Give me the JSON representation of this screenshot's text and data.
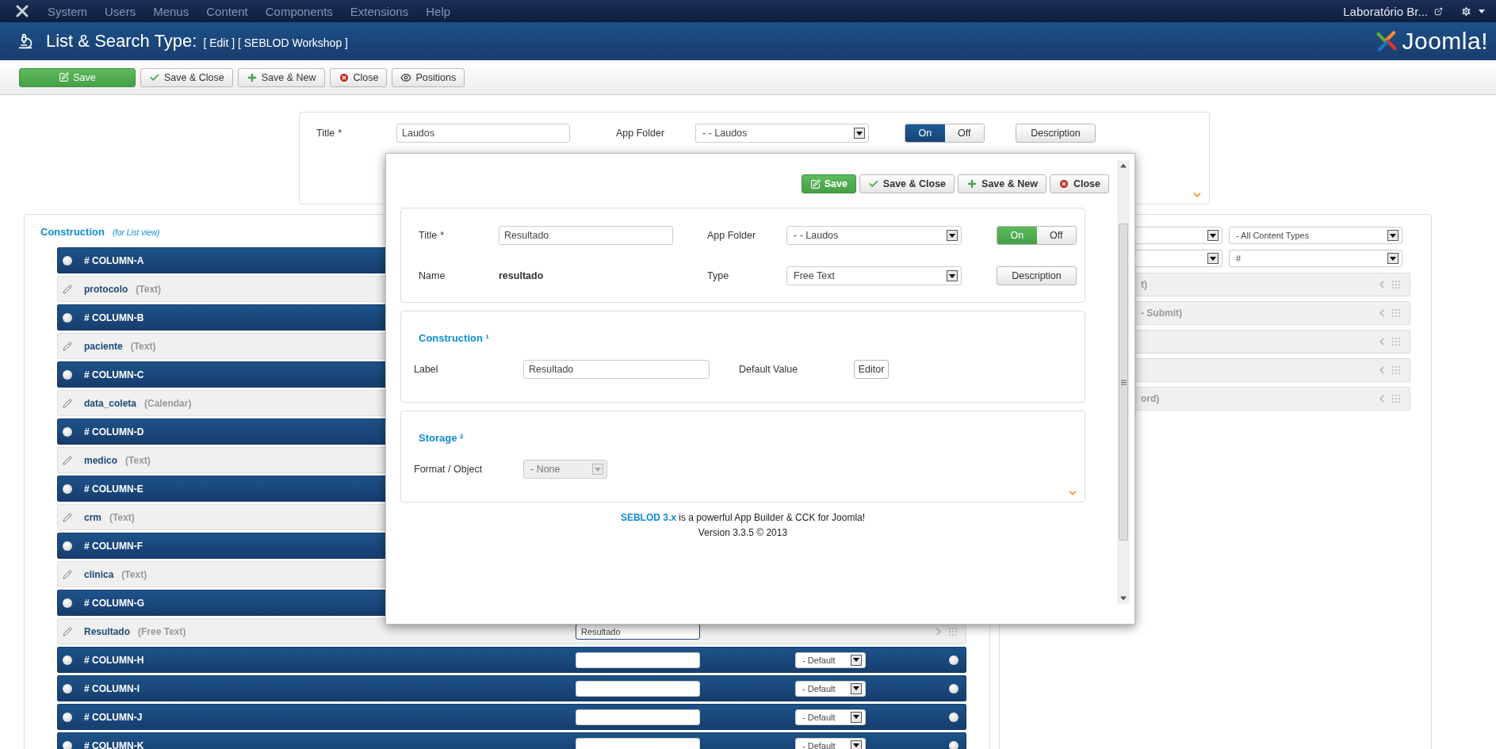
{
  "topnav": {
    "menu": [
      "System",
      "Users",
      "Menus",
      "Content",
      "Components",
      "Extensions",
      "Help"
    ],
    "site": "Laboratório Br..."
  },
  "header": {
    "title": "List & Search Type:",
    "subtitle": "[ Edit ] [ SEBLOD Workshop ]",
    "brand": "Joomla!"
  },
  "toolbar": [
    {
      "label": "Save",
      "kind": "save"
    },
    {
      "label": "Save & Close",
      "kind": "check"
    },
    {
      "label": "Save & New",
      "kind": "new"
    },
    {
      "label": "Close",
      "kind": "close"
    },
    {
      "label": "Positions",
      "kind": "view"
    }
  ],
  "main_form": {
    "title_label": "Title",
    "required": "*",
    "title_value": "Laudos",
    "folder_label": "App Folder",
    "folder_value": "- - Laudos",
    "toggle": [
      {
        "label": "On",
        "selected": true
      },
      {
        "label": "Off",
        "selected": false
      }
    ],
    "description": "Description"
  },
  "construction": {
    "title": "Construction",
    "note": "(for List view)",
    "rows": [
      {
        "kind": "column",
        "label": "# COLUMN-A"
      },
      {
        "kind": "field",
        "name": "protocolo",
        "type": "(Text)"
      },
      {
        "kind": "column",
        "label": "# COLUMN-B"
      },
      {
        "kind": "field",
        "name": "paciente",
        "type": "(Text)"
      },
      {
        "kind": "column",
        "label": "# COLUMN-C"
      },
      {
        "kind": "field",
        "name": "data_coleta",
        "type": "(Calendar)"
      },
      {
        "kind": "column",
        "label": "# COLUMN-D"
      },
      {
        "kind": "field",
        "name": "medico",
        "type": "(Text)"
      },
      {
        "kind": "column",
        "label": "# COLUMN-E"
      },
      {
        "kind": "field",
        "name": "crm",
        "type": "(Text)"
      },
      {
        "kind": "column",
        "label": "# COLUMN-F"
      },
      {
        "kind": "field",
        "name": "clinica",
        "type": "(Text)"
      },
      {
        "kind": "column",
        "label": "# COLUMN-G"
      },
      {
        "kind": "field",
        "name": "Resultado",
        "type": "(Free Text)",
        "value": "Resultado"
      },
      {
        "kind": "column",
        "label": "# COLUMN-H",
        "select": "- Default",
        "selected": false
      },
      {
        "kind": "column",
        "label": "# COLUMN-I",
        "select": "- Default",
        "selected": false
      },
      {
        "kind": "column",
        "label": "# COLUMN-J",
        "select": "- Default",
        "selected": false
      },
      {
        "kind": "column",
        "label": "# COLUMN-K",
        "select": "- Default",
        "selected": false
      }
    ]
  },
  "filters": [
    {
      "value": "- All Content Types"
    },
    {
      "value": "#"
    }
  ],
  "positions": [
    {
      "kind": "text",
      "label": "t)"
    },
    {
      "kind": "text",
      "label": "- Submit)"
    },
    {
      "kind": "blank"
    },
    {
      "kind": "blank"
    },
    {
      "kind": "text",
      "label": "ord)"
    }
  ],
  "modal": {
    "buttons": [
      {
        "label": "Save",
        "kind": "save"
      },
      {
        "label": "Save & Close",
        "kind": "check"
      },
      {
        "label": "Save & New",
        "kind": "new"
      },
      {
        "label": "Close",
        "kind": "close"
      }
    ],
    "title_label": "Title",
    "required": "*",
    "title_value": "Resultado",
    "folder_label": "App Folder",
    "folder_value": "- - Laudos",
    "toggle": [
      {
        "label": "On",
        "selected": true
      },
      {
        "label": "Off",
        "selected": false
      }
    ],
    "name_label": "Name",
    "name_value": "resultado",
    "type_label": "Type",
    "type_value": "Free Text",
    "description": "Description",
    "construction_title": "Construction ¹",
    "label_label": "Label",
    "label_value": "Resultado",
    "default_label": "Default Value",
    "editor": "Editor",
    "storage_title": "Storage ²",
    "format_label": "Format / Object",
    "format_value": "- None",
    "format_disabled": true,
    "footer_link": "SEBLOD 3.x",
    "footer_text": "is a powerful App Builder & CCK for Joomla!",
    "version": "Version 3.3.5 © 2013"
  }
}
